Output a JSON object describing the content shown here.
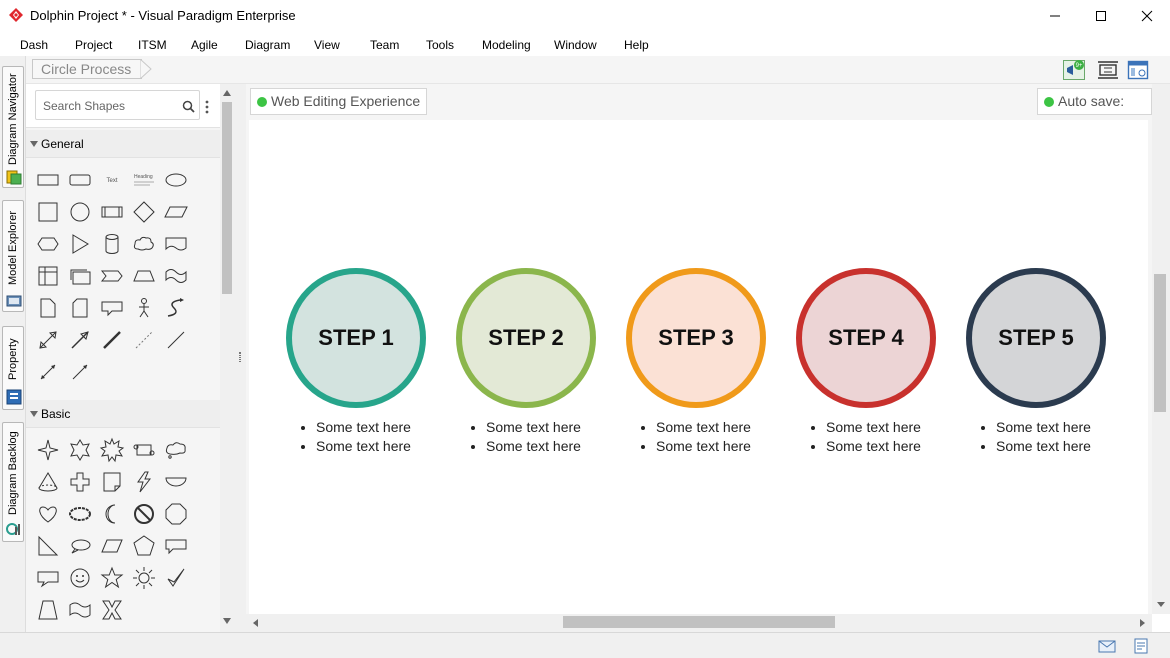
{
  "window": {
    "title": "Dolphin Project * - Visual Paradigm Enterprise",
    "brand_color": "#e0282e"
  },
  "menu": [
    "Dash",
    "Project",
    "ITSM",
    "Agile",
    "Diagram",
    "View",
    "Team",
    "Tools",
    "Modeling",
    "Window",
    "Help"
  ],
  "left_tabs": [
    {
      "label": "Diagram Navigator",
      "icon": "diagram-navigator-icon"
    },
    {
      "label": "Model Explorer",
      "icon": "model-explorer-icon"
    },
    {
      "label": "Property",
      "icon": "property-icon"
    },
    {
      "label": "Diagram Backlog",
      "icon": "diagram-backlog-icon"
    }
  ],
  "breadcrumb": "Circle Process",
  "toolbar": {
    "notification_badge": "9+"
  },
  "palette": {
    "search_placeholder": "Search Shapes",
    "sections": [
      {
        "title": "General"
      },
      {
        "title": "Basic"
      }
    ],
    "general_text_shape": "Text",
    "general_heading_shape": "Heading"
  },
  "canvas": {
    "web_editing_label": "Web Editing Experience",
    "auto_save_label": "Auto save: On",
    "status_color": "#3cc444"
  },
  "steps": [
    {
      "label": "STEP 1",
      "border": "#27a58b",
      "fill": "#d3e3df",
      "bullets": [
        "Some text here",
        "Some text here"
      ]
    },
    {
      "label": "STEP 2",
      "border": "#8bb64c",
      "fill": "#e3e9d6",
      "bullets": [
        "Some text here",
        "Some text here"
      ]
    },
    {
      "label": "STEP 3",
      "border": "#f09a1a",
      "fill": "#fbe1d5",
      "bullets": [
        "Some text here",
        "Some text here"
      ]
    },
    {
      "label": "STEP 4",
      "border": "#c8312d",
      "fill": "#ecd4d5",
      "bullets": [
        "Some text here",
        "Some text here"
      ]
    },
    {
      "label": "STEP 5",
      "border": "#2b3b4f",
      "fill": "#d4d5d7",
      "bullets": [
        "Some text here",
        "Some text here"
      ]
    }
  ]
}
